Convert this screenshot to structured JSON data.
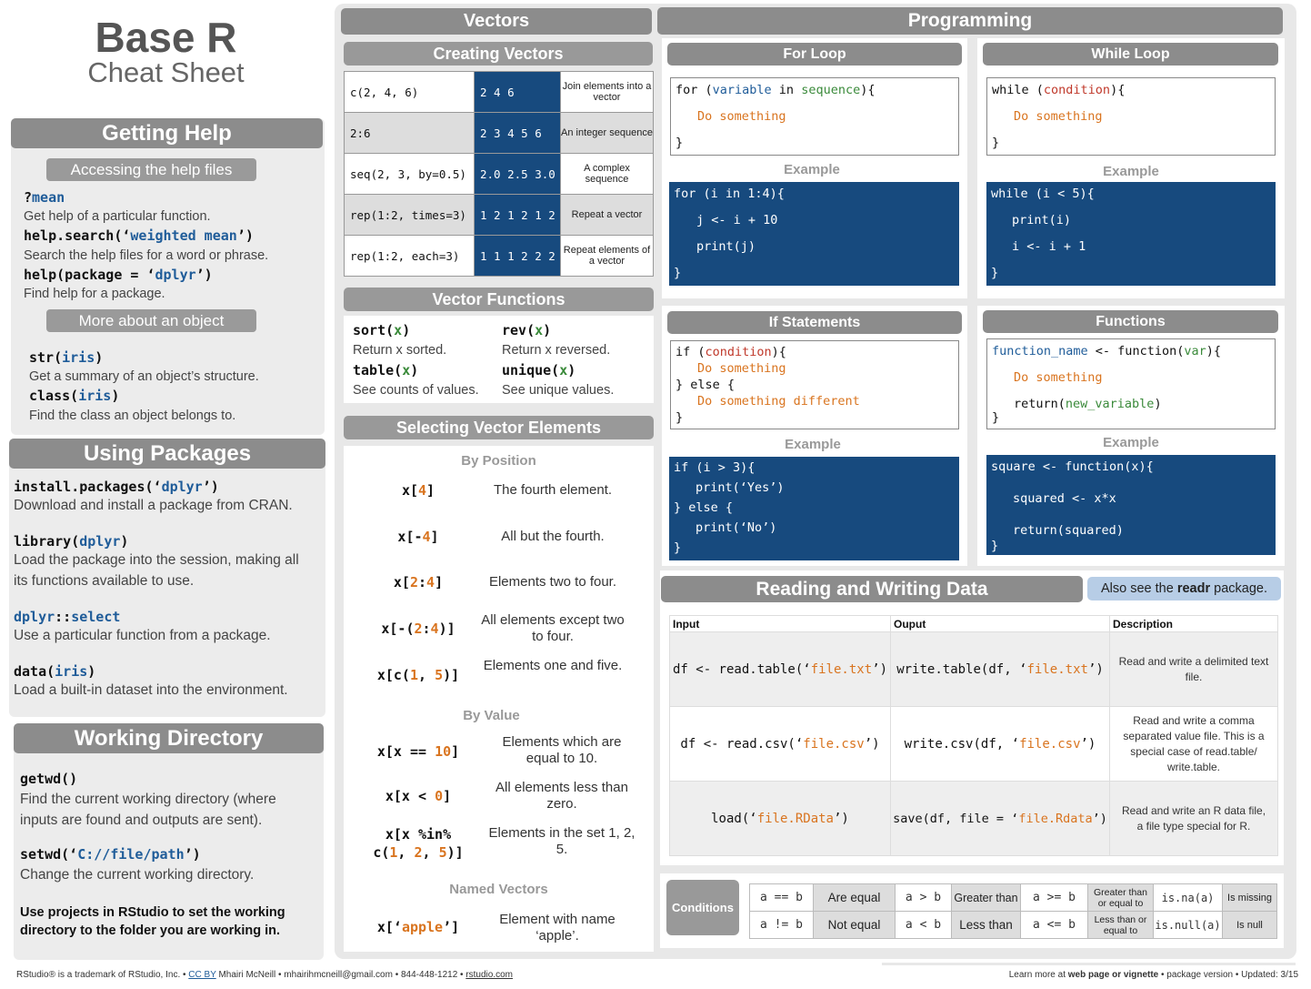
{
  "title": {
    "main": "Base R",
    "sub": "Cheat Sheet"
  },
  "getting_help": {
    "header": "Getting Help",
    "sub1": "Accessing the help files",
    "sub2": "More about an object",
    "fn1": "?",
    "fn1a": "mean",
    "d1": "Get help of a particular function.",
    "fn2": "help.search(‘",
    "fn2a": "weighted mean",
    "fn2b": "’)",
    "d2": "Search the help files for a word or phrase.",
    "fn3": "help(package = ‘",
    "fn3a": "dplyr",
    "fn3b": "’)",
    "d3": "Find help for a package.",
    "fn4": "str(",
    "fn4a": "iris",
    "fn4b": ")",
    "d4": "Get a summary of an object’s structure.",
    "fn5": "class(",
    "fn5a": "iris",
    "fn5b": ")",
    "d5": "Find the class an object belongs to."
  },
  "using_packages": {
    "header": "Using Packages",
    "fn1": "install.packages(‘",
    "fn1a": "dplyr",
    "fn1b": "’)",
    "d1": "Download and install a package from CRAN.",
    "fn2": "library(",
    "fn2a": "dplyr",
    "fn2b": ")",
    "d2a": "Load the package into the session, making all",
    "d2b": "its functions available to use.",
    "fn3a": "dplyr",
    "fn3": "::",
    "fn3b": "select",
    "d3": "Use a particular function from a package.",
    "fn4": "data(",
    "fn4a": "iris",
    "fn4b": ")",
    "d4": "Load a built-in dataset into the environment."
  },
  "working_directory": {
    "header": "Working Directory",
    "fn1": "getwd()",
    "d1a": "Find the current working directory (where",
    "d1b": "inputs are found and outputs are sent).",
    "fn2": "setwd(‘",
    "fn2a": "C://file/path",
    "fn2b": "’)",
    "d2": "Change the current working directory.",
    "note1": "Use projects in RStudio to set the working",
    "note2": "directory to the folder you are working in."
  },
  "vectors": {
    "header": "Vectors",
    "creating": "Creating Vectors",
    "rows": [
      {
        "code": "c(2, 4, 6)",
        "out": "2 4 6",
        "desc": "Join elements into a vector"
      },
      {
        "code": "2:6",
        "out": "2 3 4 5 6",
        "desc": "An integer sequence"
      },
      {
        "code": "seq(2, 3, by=0.5)",
        "out": "2.0 2.5 3.0",
        "desc": "A complex sequence"
      },
      {
        "code": "rep(1:2, times=3)",
        "out": "1 2 1 2 1 2",
        "desc": "Repeat a vector"
      },
      {
        "code": "rep(1:2, each=3)",
        "out": "1 1 1 2 2 2",
        "desc": "Repeat elements of a vector"
      }
    ],
    "functions": "Vector Functions",
    "f1": "sort(",
    "f1d": "Return x sorted.",
    "f2": "rev(",
    "f2d": "Return x reversed.",
    "f3": "table(",
    "f3d": "See counts of values.",
    "f4": "unique(",
    "f4d": "See unique values.",
    "fx": "x",
    "fclose": ")",
    "selecting": "Selecting Vector Elements",
    "by_position": "By Position",
    "by_value": "By Value",
    "named": "Named Vectors",
    "s1d": "The fourth element.",
    "s2d": "All but the fourth.",
    "s3d": "Elements two to four.",
    "s4d": "All elements except two to four.",
    "s5d": "Elements one and five.",
    "s6d": "Elements which are equal to 10.",
    "s7d": "All elements less than zero.",
    "s8d": "Elements in the set 1, 2, 5.",
    "s9d": "Element with name ‘apple’."
  },
  "programming": {
    "header": "Programming",
    "for_loop": "For Loop",
    "while_loop": "While Loop",
    "if_statements": "If Statements",
    "functions": "Functions",
    "example": "Example"
  },
  "reading": {
    "header": "Reading and Writing Data",
    "also": "Also see the ",
    "readr": "readr",
    "package": " package.",
    "cols": [
      "Input",
      "Ouput",
      "Description"
    ],
    "rows": [
      {
        "d": "Read and write a delimited text file."
      },
      {
        "d": "Read and write a comma separated value file. This is a special case of read.table/ write.table."
      },
      {
        "d": "Read and write an R data file, a file type special for R."
      }
    ]
  },
  "conditions": {
    "label": "Conditions",
    "r1": [
      [
        "a == b",
        "Are equal"
      ],
      [
        "a > b",
        "Greater than"
      ],
      [
        "a >= b",
        "Greater than or equal to"
      ],
      [
        "is.na(a)",
        "Is missing"
      ]
    ],
    "r2": [
      [
        "a != b",
        "Not equal"
      ],
      [
        "a < b",
        "Less than"
      ],
      [
        "a <= b",
        "Less than or equal to"
      ],
      [
        "is.null(a)",
        "Is null"
      ]
    ]
  },
  "footer": {
    "left1": "RStudio",
    "left2": "® is a trademark of RStudio, Inc.  •  ",
    "ccby": "CC BY",
    "left3": " Mhairi McNeill  •  mhairihmcneill@gmail.com  •  844-448-1212  •  ",
    "site": "rstudio.com",
    "right1": "Learn more at ",
    "right2": "web page or vignette",
    "right3": "  •  package  version  •  Updated: 3/15"
  }
}
